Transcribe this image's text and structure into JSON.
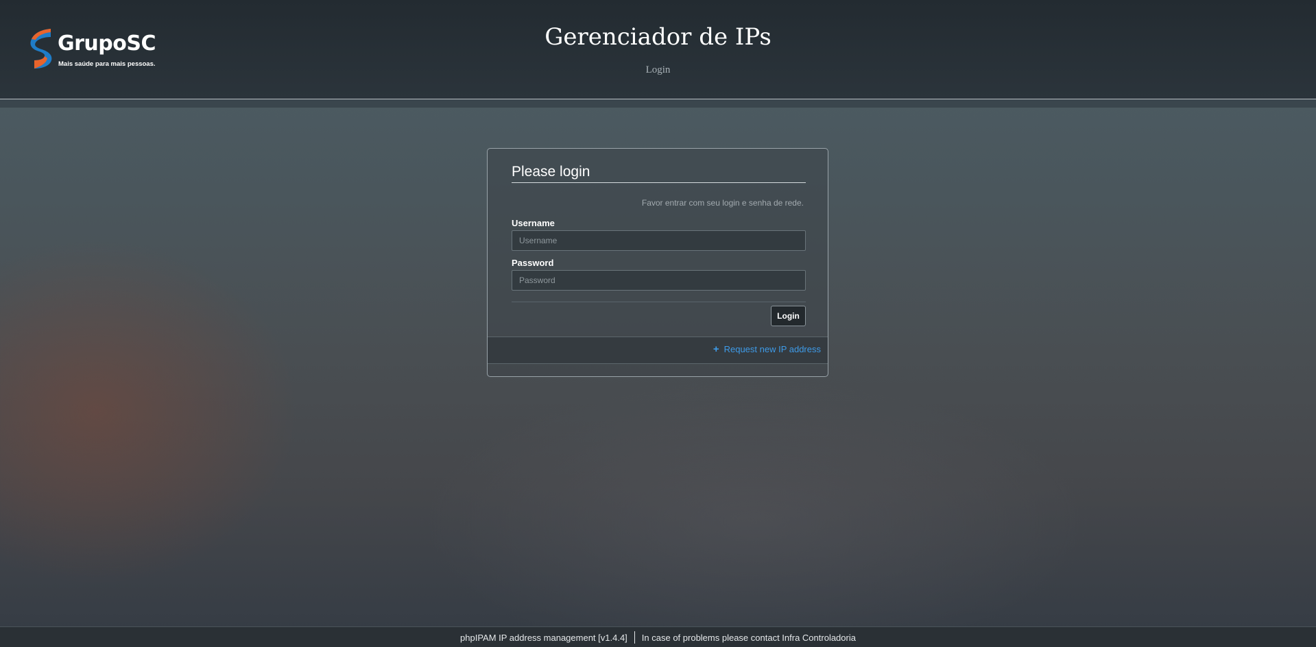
{
  "header": {
    "logo": {
      "name": "GrupoSC",
      "tagline": "Mais saúde para mais pessoas.",
      "colors": {
        "blue": "#1f7cc7",
        "orange": "#e8642c"
      }
    },
    "title": "Gerenciador de IPs",
    "subtitle": "Login"
  },
  "login": {
    "heading": "Please login",
    "hint": "Favor entrar com seu login e senha de rede.",
    "username": {
      "label": "Username",
      "placeholder": "Username",
      "value": ""
    },
    "password": {
      "label": "Password",
      "placeholder": "Password",
      "value": ""
    },
    "submit_label": "Login",
    "request_link": {
      "icon": "plus-icon",
      "label": "Request new IP address",
      "color": "#3e9be8"
    }
  },
  "footer": {
    "app_version": "phpIPAM IP address management [v1.4.4]",
    "contact": "In case of problems please contact Infra Controladoria"
  }
}
